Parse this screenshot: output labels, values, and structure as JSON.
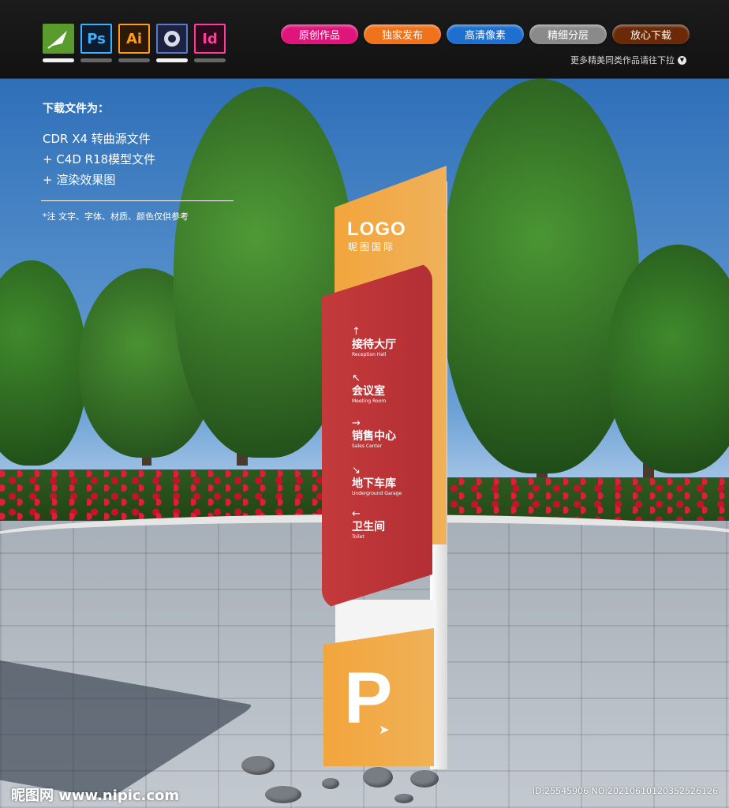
{
  "header": {
    "app_icons": [
      {
        "name": "coreldraw-icon",
        "label": "",
        "active": true
      },
      {
        "name": "photoshop-icon",
        "label": "Ps",
        "active": false
      },
      {
        "name": "illustrator-icon",
        "label": "Ai",
        "active": false
      },
      {
        "name": "cinema4d-icon",
        "label": "",
        "active": true
      },
      {
        "name": "indesign-icon",
        "label": "Id",
        "active": false
      }
    ],
    "pills": [
      {
        "label": "原创作品",
        "color": "#e0157b"
      },
      {
        "label": "独家发布",
        "color": "#f0721a"
      },
      {
        "label": "高清像素",
        "color": "#1f6fd1"
      },
      {
        "label": "精细分层",
        "color": "#8a8a8a"
      },
      {
        "label": "放心下载",
        "color": "#6a2a08"
      }
    ],
    "more_text": "更多精美同类作品请往下拉",
    "more_icon": "chevron-down-circle-icon"
  },
  "info": {
    "title": "下载文件为：",
    "lines": [
      "CDR X4 转曲源文件",
      "+ C4D R18模型文件",
      "+ 渲染效果图"
    ],
    "note": "*注  文字、字体、材质、颜色仅供参考"
  },
  "sign": {
    "logo": "LOGO",
    "logo_sub": "昵图国际",
    "directions": [
      {
        "arrow": "↑",
        "cn": "接待大厅",
        "en": "Reception Hall"
      },
      {
        "arrow": "↖",
        "cn": "会议室",
        "en": "Meeting Room"
      },
      {
        "arrow": "→",
        "cn": "销售中心",
        "en": "Sales Center"
      },
      {
        "arrow": "↘",
        "cn": "地下车库",
        "en": "Underground Garage"
      },
      {
        "arrow": "←",
        "cn": "卫生间",
        "en": "Toilet"
      }
    ],
    "parking": "P",
    "parking_arrow": "➤"
  },
  "watermark": {
    "left": "昵图网 www.nipic.com",
    "right": "ID:25545906 NO:20210610120352526126"
  }
}
